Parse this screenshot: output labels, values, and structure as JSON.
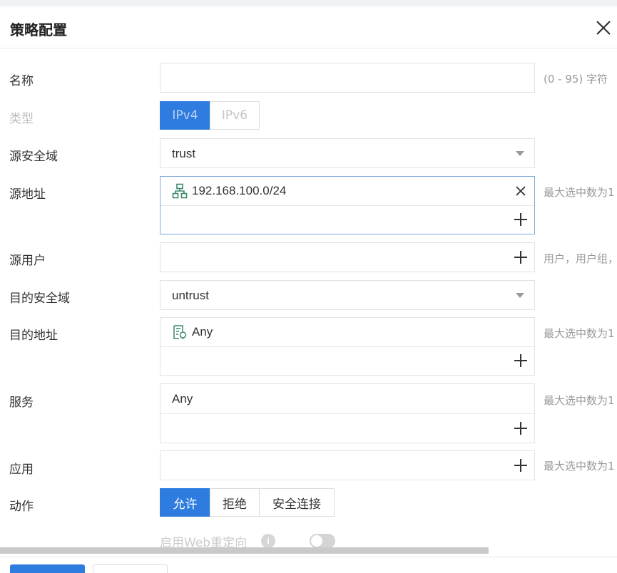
{
  "dialog": {
    "title": "策略配置"
  },
  "form": {
    "name": {
      "label": "名称",
      "value": "",
      "hint": "(0 - 95) 字符"
    },
    "type": {
      "label": "类型",
      "options": [
        "IPv4",
        "IPv6"
      ],
      "selected": "IPv4"
    },
    "src_zone": {
      "label": "源安全域",
      "value": "trust"
    },
    "src_addr": {
      "label": "源地址",
      "items": [
        "192.168.100.0/24"
      ],
      "hint": "最大选中数为1"
    },
    "src_user": {
      "label": "源用户",
      "hint": "用户，用户组，"
    },
    "dst_zone": {
      "label": "目的安全域",
      "value": "untrust"
    },
    "dst_addr": {
      "label": "目的地址",
      "items": [
        "Any"
      ],
      "hint": "最大选中数为1"
    },
    "service": {
      "label": "服务",
      "items": [
        "Any"
      ],
      "hint": "最大选中数为1"
    },
    "app": {
      "label": "应用",
      "hint": "最大选中数为1"
    },
    "action": {
      "label": "动作",
      "options": [
        "允许",
        "拒绝",
        "安全连接"
      ],
      "selected": "允许"
    },
    "web_redirect": {
      "label": "启用Web重定向",
      "enabled": false
    }
  },
  "colors": {
    "accent": "#2f7ce0",
    "icon_green": "#3a8a6a"
  },
  "icons": {
    "close": "close-icon",
    "network": "network-icon",
    "address": "address-icon",
    "add": "plus-icon",
    "dropdown": "caret-down-icon",
    "info": "info-icon"
  }
}
